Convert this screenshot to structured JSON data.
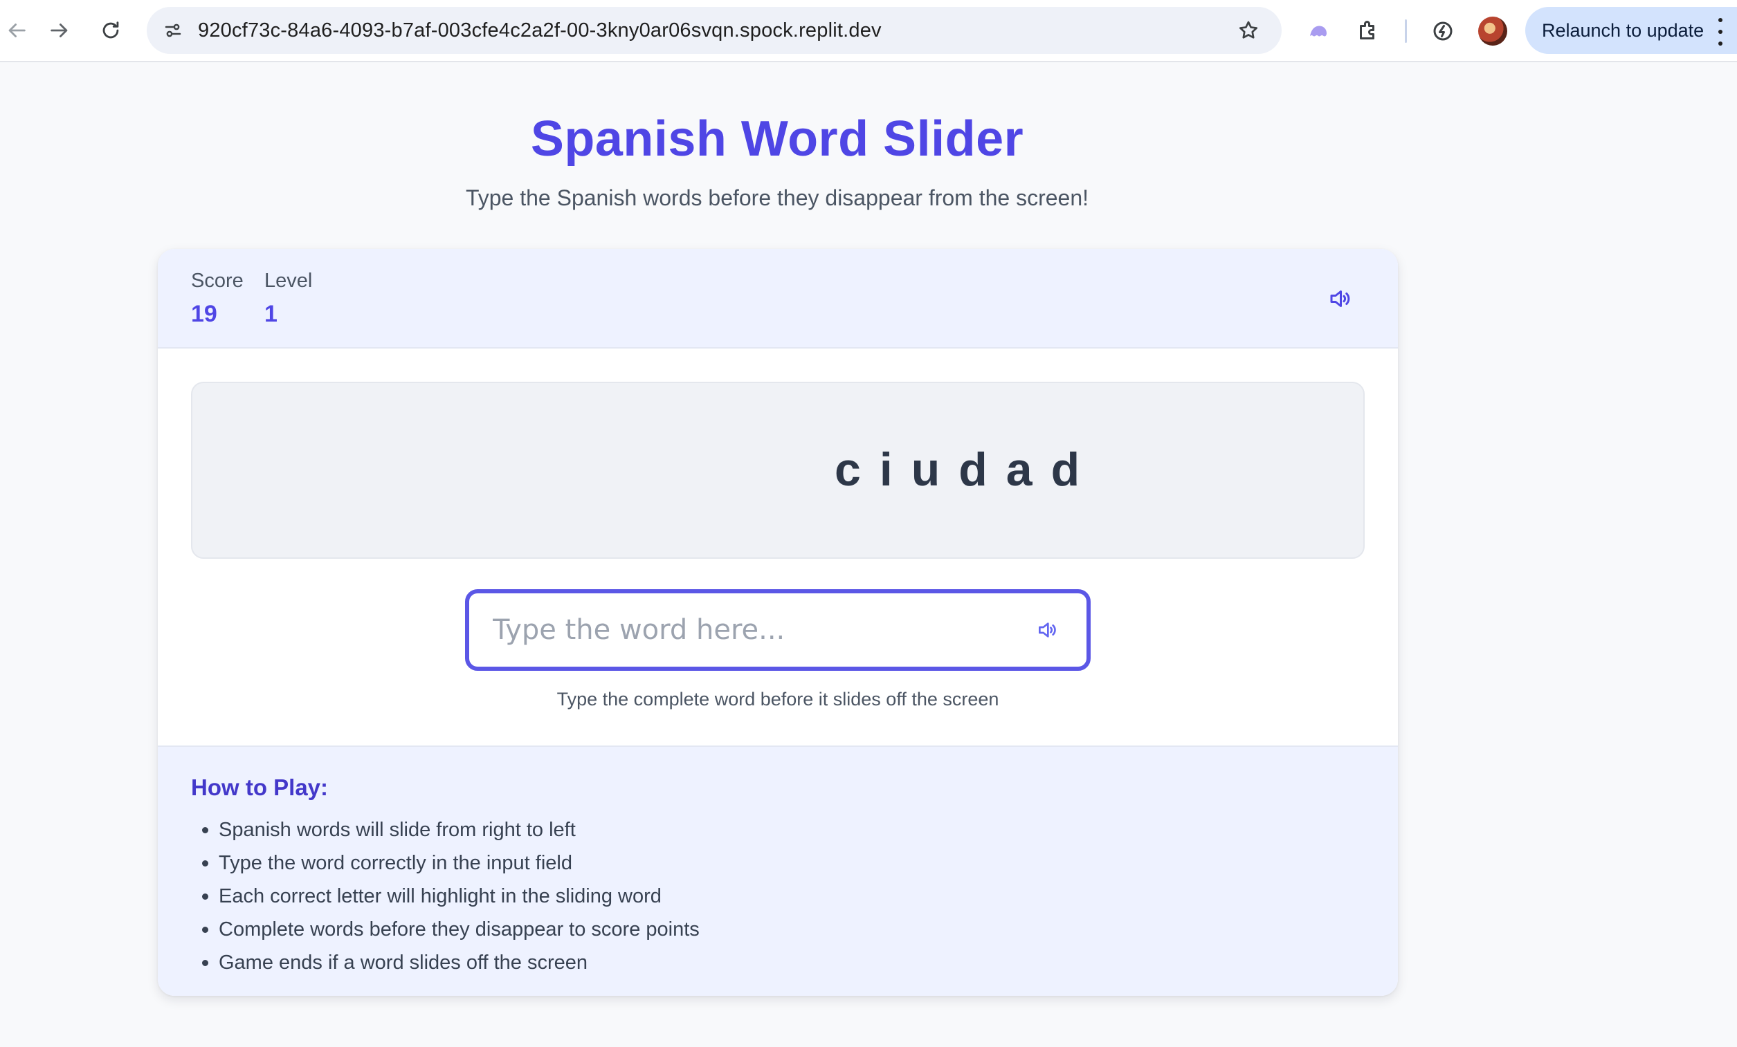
{
  "browser": {
    "url": "920cf73c-84a6-4093-b7af-003cfe4c2a2f-00-3kny0ar06svqn.spock.replit.dev",
    "relaunch_label": "Relaunch to update",
    "icons": [
      "back-arrow-icon",
      "forward-arrow-icon",
      "reload-icon",
      "site-info-icon",
      "bookmark-star-icon",
      "extension-ghost-icon",
      "extensions-puzzle-icon",
      "performance-icon",
      "profile-avatar",
      "more-menu-icon"
    ]
  },
  "header": {
    "title": "Spanish Word Slider",
    "subtitle": "Type the Spanish words before they disappear from the screen!"
  },
  "stats": {
    "score_label": "Score",
    "score_value": "19",
    "level_label": "Level",
    "level_value": "1"
  },
  "game": {
    "current_word": "ciudad",
    "input_value": "",
    "input_placeholder": "Type the word here...",
    "hint": "Type the complete word before it slides off the screen"
  },
  "how_to_play": {
    "title": "How to Play:",
    "rules": [
      "Spanish words will slide from right to left",
      "Type the word correctly in the input field",
      "Each correct letter will highlight in the sliding word",
      "Complete words before they disappear to score points",
      "Game ends if a word slides off the screen"
    ]
  },
  "colors": {
    "accent": "#4f46e5",
    "input_border": "#5b57e6",
    "header_bg": "#eef2ff",
    "page_bg": "#f8f9fb"
  }
}
